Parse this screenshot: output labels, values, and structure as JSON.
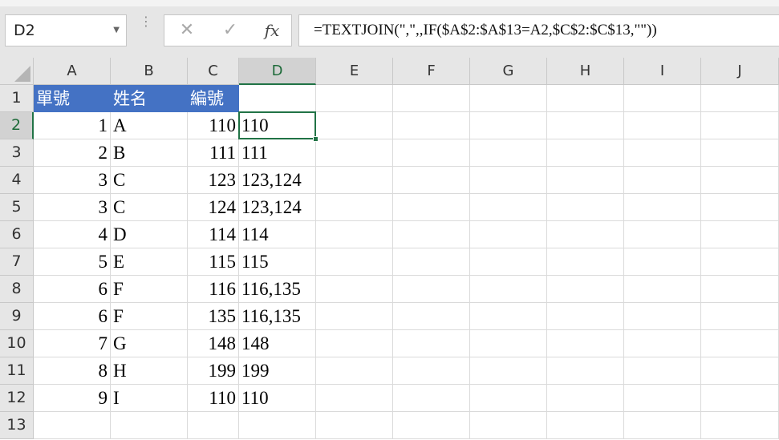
{
  "formula_bar": {
    "name_box": "D2",
    "formula": "=TEXTJOIN(\",\",,IF($A$2:$A$13=A2,$C$2:$C$13,\"\"))",
    "cancel_icon": "close-icon",
    "enter_icon": "check-icon",
    "function_icon": "fx-icon"
  },
  "grid": {
    "columns": [
      "A",
      "B",
      "C",
      "D",
      "E",
      "F",
      "G",
      "H",
      "I",
      "J"
    ],
    "rows": [
      "1",
      "2",
      "3",
      "4",
      "5",
      "6",
      "7",
      "8",
      "9",
      "10",
      "11",
      "12",
      "13"
    ],
    "selected_column": "D",
    "selected_row": "2",
    "header_row": [
      "單號",
      "姓名",
      "編號",
      ""
    ],
    "data": [
      [
        "1",
        "A",
        "110",
        "110"
      ],
      [
        "2",
        "B",
        "111",
        "111"
      ],
      [
        "3",
        "C",
        "123",
        "123,124"
      ],
      [
        "3",
        "C",
        "124",
        "123,124"
      ],
      [
        "4",
        "D",
        "114",
        "114"
      ],
      [
        "5",
        "E",
        "115",
        "115"
      ],
      [
        "6",
        "F",
        "116",
        "116,135"
      ],
      [
        "6",
        "F",
        "135",
        "116,135"
      ],
      [
        "7",
        "G",
        "148",
        "148"
      ],
      [
        "8",
        "H",
        "199",
        "199"
      ],
      [
        "9",
        "I",
        "110",
        "110"
      ]
    ],
    "colors": {
      "header_fill": "#4472c4",
      "selection": "#217346"
    }
  }
}
